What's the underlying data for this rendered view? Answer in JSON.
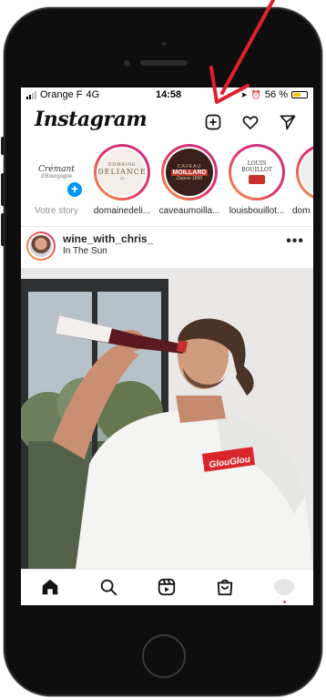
{
  "status": {
    "carrier": "Orange F",
    "network": "4G",
    "time": "14:58",
    "battery": "56 %",
    "battery_level": 0.56
  },
  "header": {
    "logo": "Instagram",
    "icons": [
      "new-post-icon",
      "heart-icon",
      "direct-message-icon"
    ]
  },
  "stories": [
    {
      "name": "Votre story",
      "label_line1": "Crémant",
      "label_line2": "d'Bourgogne",
      "own": true
    },
    {
      "name": "domainedeli...",
      "label_line1": "DOMAINE",
      "label_line2": "DELIANCE"
    },
    {
      "name": "caveaumoilla...",
      "label_line1": "CAVEAU",
      "label_line2": "MOILLARD",
      "label_line3": "Depuis 1850"
    },
    {
      "name": "louisbouillot...",
      "label_line1": "LOUIS BOUILLOT"
    },
    {
      "name": "dom"
    }
  ],
  "post": {
    "username": "wine_with_chris_",
    "location": "In The Sun",
    "more": "•••",
    "shirt_text": "GlouGlou"
  },
  "tabs": [
    "home-icon",
    "search-icon",
    "reels-icon",
    "shop-icon",
    "profile-icon"
  ],
  "colors": {
    "accent_blue": "#0095f6",
    "story_gradient_start": "#f9a03f",
    "story_gradient_end": "#c13584",
    "annotation_red": "#e0202a",
    "notification_dot": "#ed4956"
  }
}
